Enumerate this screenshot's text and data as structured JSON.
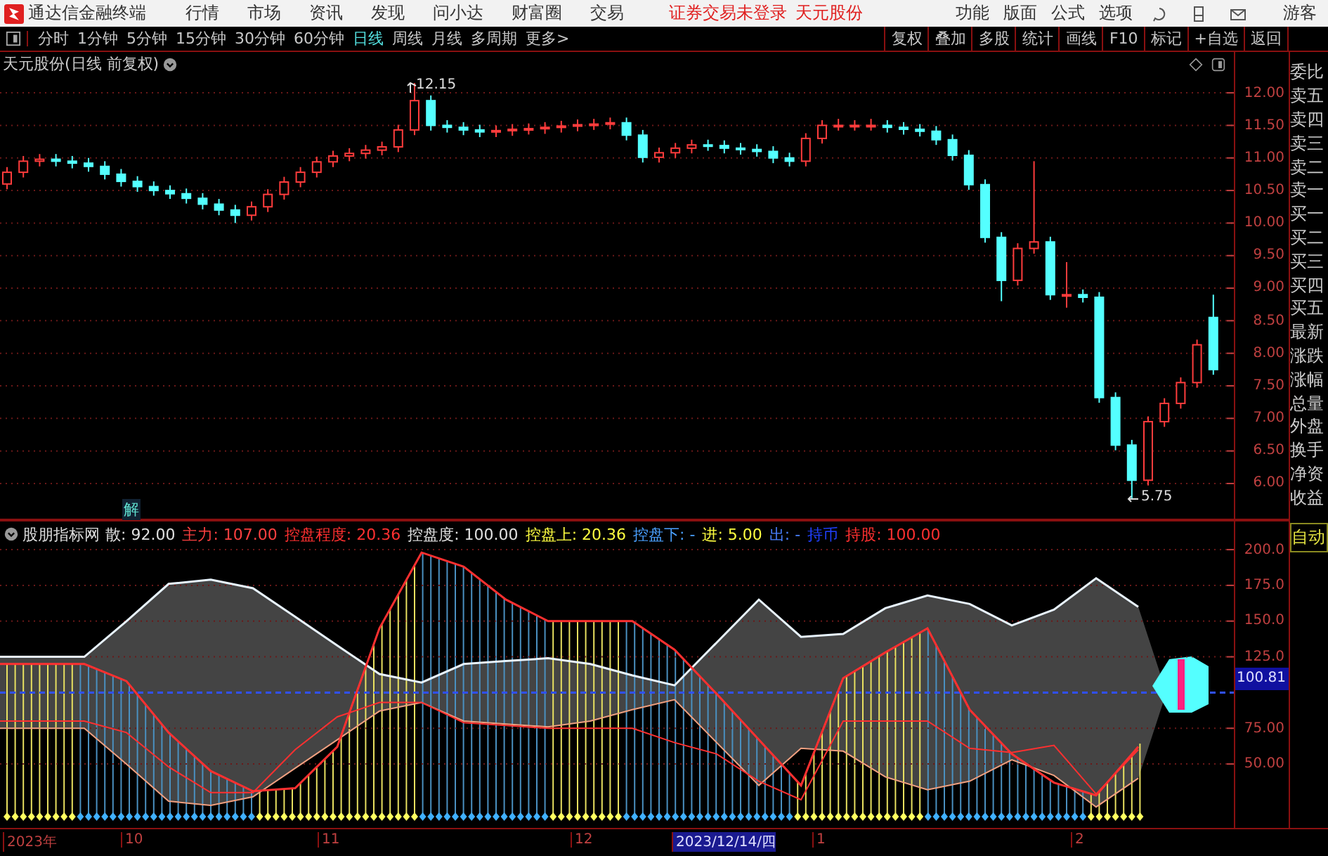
{
  "app": {
    "title": "通达信金融终端"
  },
  "menu": [
    "行情",
    "市场",
    "资讯",
    "发现",
    "问小达",
    "财富圈",
    "交易"
  ],
  "status": [
    "证券交易未登录",
    "天元股份"
  ],
  "right_menu": [
    "功能",
    "版面",
    "公式",
    "选项"
  ],
  "user": "游客",
  "periods": [
    {
      "label": "分时",
      "selected": false
    },
    {
      "label": "1分钟",
      "selected": false
    },
    {
      "label": "5分钟",
      "selected": false
    },
    {
      "label": "15分钟",
      "selected": false
    },
    {
      "label": "30分钟",
      "selected": false
    },
    {
      "label": "60分钟",
      "selected": false
    },
    {
      "label": "日线",
      "selected": true
    },
    {
      "label": "周线",
      "selected": false
    },
    {
      "label": "月线",
      "selected": false
    },
    {
      "label": "多周期",
      "selected": false
    },
    {
      "label": "更多>",
      "selected": false
    }
  ],
  "tools": [
    "复权",
    "叠加",
    "多股",
    "统计",
    "画线",
    "F10",
    "标记",
    "+自选",
    "返回"
  ],
  "chart": {
    "title": "天元股份(日线 前复权)",
    "high_label": "12.15",
    "low_label": "5.75",
    "chart_data": {
      "type": "candlestick",
      "grid": true,
      "ylim": [
        5.46,
        12.26
      ],
      "yticks": [
        {
          "value": 12,
          "label": "12.00"
        },
        {
          "value": 11.5,
          "label": "11.50"
        },
        {
          "value": 11,
          "label": "11.00"
        },
        {
          "value": 10.5,
          "label": "10.50"
        },
        {
          "value": 10,
          "label": "10.00"
        },
        {
          "value": 9.5,
          "label": "9.50"
        },
        {
          "value": 9,
          "label": "9.00"
        },
        {
          "value": 8.5,
          "label": "8.50"
        },
        {
          "value": 8,
          "label": "8.00"
        },
        {
          "value": 7.5,
          "label": "7.50"
        },
        {
          "value": 7,
          "label": "7.00"
        },
        {
          "value": 6.5,
          "label": "6.50"
        },
        {
          "value": 6,
          "label": "6.00"
        }
      ],
      "ohlc": [
        [
          10.6,
          10.86,
          10.52,
          10.78
        ],
        [
          10.78,
          11.03,
          10.7,
          10.95
        ],
        [
          10.95,
          11.06,
          10.87,
          10.98
        ],
        [
          10.98,
          11.06,
          10.87,
          10.95
        ],
        [
          10.95,
          11.03,
          10.84,
          10.92
        ],
        [
          10.92,
          11.0,
          10.79,
          10.87
        ],
        [
          10.87,
          10.95,
          10.67,
          10.75
        ],
        [
          10.75,
          10.83,
          10.56,
          10.64
        ],
        [
          10.64,
          10.72,
          10.48,
          10.56
        ],
        [
          10.56,
          10.64,
          10.42,
          10.5
        ],
        [
          10.5,
          10.58,
          10.37,
          10.45
        ],
        [
          10.45,
          10.53,
          10.3,
          10.38
        ],
        [
          10.38,
          10.46,
          10.21,
          10.29
        ],
        [
          10.29,
          10.37,
          10.12,
          10.2
        ],
        [
          10.2,
          10.28,
          10.0,
          10.12
        ],
        [
          10.12,
          10.33,
          10.04,
          10.25
        ],
        [
          10.25,
          10.52,
          10.17,
          10.44
        ],
        [
          10.44,
          10.71,
          10.36,
          10.63
        ],
        [
          10.63,
          10.86,
          10.55,
          10.78
        ],
        [
          10.78,
          11.02,
          10.7,
          10.94
        ],
        [
          10.94,
          11.11,
          10.86,
          11.03
        ],
        [
          11.03,
          11.15,
          10.95,
          11.07
        ],
        [
          11.07,
          11.2,
          10.99,
          11.12
        ],
        [
          11.12,
          11.25,
          11.04,
          11.17
        ],
        [
          11.17,
          11.51,
          11.09,
          11.43
        ],
        [
          11.43,
          12.15,
          11.35,
          11.88
        ],
        [
          11.88,
          11.96,
          11.42,
          11.5
        ],
        [
          11.5,
          11.58,
          11.39,
          11.47
        ],
        [
          11.47,
          11.55,
          11.35,
          11.43
        ],
        [
          11.43,
          11.51,
          11.32,
          11.4
        ],
        [
          11.4,
          11.5,
          11.32,
          11.42
        ],
        [
          11.42,
          11.52,
          11.34,
          11.44
        ],
        [
          11.44,
          11.53,
          11.36,
          11.45
        ],
        [
          11.45,
          11.55,
          11.37,
          11.47
        ],
        [
          11.47,
          11.57,
          11.39,
          11.49
        ],
        [
          11.49,
          11.59,
          11.41,
          11.51
        ],
        [
          11.51,
          11.6,
          11.43,
          11.52
        ],
        [
          11.52,
          11.62,
          11.44,
          11.54
        ],
        [
          11.54,
          11.62,
          11.27,
          11.35
        ],
        [
          11.35,
          11.43,
          10.93,
          11.01
        ],
        [
          11.01,
          11.16,
          10.93,
          11.08
        ],
        [
          11.08,
          11.23,
          11.0,
          11.15
        ],
        [
          11.15,
          11.28,
          11.07,
          11.2
        ],
        [
          11.2,
          11.28,
          11.11,
          11.19
        ],
        [
          11.19,
          11.27,
          11.07,
          11.15
        ],
        [
          11.15,
          11.23,
          11.05,
          11.13
        ],
        [
          11.13,
          11.21,
          11.02,
          11.1
        ],
        [
          11.1,
          11.18,
          10.92,
          11.0
        ],
        [
          11.0,
          11.08,
          10.87,
          10.95
        ],
        [
          10.95,
          11.38,
          10.87,
          11.3
        ],
        [
          11.3,
          11.58,
          11.22,
          11.5
        ],
        [
          11.5,
          11.6,
          11.42,
          11.5
        ],
        [
          11.5,
          11.58,
          11.42,
          11.5
        ],
        [
          11.5,
          11.6,
          11.42,
          11.5
        ],
        [
          11.5,
          11.58,
          11.39,
          11.47
        ],
        [
          11.47,
          11.55,
          11.36,
          11.44
        ],
        [
          11.44,
          11.52,
          11.33,
          11.41
        ],
        [
          11.41,
          11.49,
          11.2,
          11.28
        ],
        [
          11.28,
          11.36,
          10.96,
          11.04
        ],
        [
          11.04,
          11.12,
          10.51,
          10.59
        ],
        [
          10.59,
          10.67,
          9.7,
          9.78
        ],
        [
          9.78,
          9.86,
          8.8,
          9.12
        ],
        [
          9.12,
          9.69,
          9.04,
          9.61
        ],
        [
          9.61,
          10.95,
          9.53,
          9.71
        ],
        [
          9.71,
          9.79,
          8.82,
          8.9
        ],
        [
          8.9,
          9.4,
          8.7,
          8.9
        ],
        [
          8.9,
          8.98,
          8.78,
          8.86
        ],
        [
          8.86,
          8.94,
          7.24,
          7.32
        ],
        [
          7.32,
          7.4,
          6.51,
          6.59
        ],
        [
          6.59,
          6.67,
          5.75,
          6.05
        ],
        [
          6.05,
          7.03,
          5.97,
          6.95
        ],
        [
          6.95,
          7.31,
          6.87,
          7.23
        ],
        [
          7.23,
          7.63,
          7.15,
          7.55
        ],
        [
          7.55,
          8.21,
          7.47,
          8.13
        ],
        [
          8.55,
          8.9,
          7.67,
          7.75
        ]
      ]
    }
  },
  "signal": "解",
  "indicator": {
    "name": "股朋指标网",
    "items": [
      {
        "label": "散:",
        "value": "92.00",
        "color": "#e0e0e0"
      },
      {
        "label": "主力:",
        "value": "107.00",
        "color": "#ff4040"
      },
      {
        "label": "控盘程度:",
        "value": "20.36",
        "color": "#ff3030"
      },
      {
        "label": "控盘度:",
        "value": "100.00",
        "color": "#e0e0e0"
      },
      {
        "label": "控盘上:",
        "value": "20.36",
        "color": "#ffff40"
      },
      {
        "label": "控盘下:",
        "value": "-",
        "color": "#4aa0ff"
      },
      {
        "label": "进:",
        "value": "5.00",
        "color": "#ffff40"
      },
      {
        "label": "出:",
        "value": "-",
        "color": "#4a80ff"
      },
      {
        "label": "持币",
        "value": "",
        "color": "#2040ff"
      },
      {
        "label": "持股:",
        "value": "100.00",
        "color": "#ff3030"
      }
    ],
    "current": "100.81",
    "chart_data": {
      "type": "line",
      "grid": true,
      "ylim": [
        5.3,
        202
      ],
      "yticks": [
        {
          "value": 200,
          "label": "200.0"
        },
        {
          "value": 175,
          "label": "175.0"
        },
        {
          "value": 150,
          "label": "150.0"
        },
        {
          "value": 125,
          "label": "125.0"
        },
        {
          "value": 75,
          "label": "75.00"
        },
        {
          "value": 50,
          "label": "50.00"
        }
      ],
      "series": [
        {
          "color": "#e8f4ff",
          "values": [
            125,
            125,
            125,
            150,
            176,
            179,
            173,
            153,
            133,
            113,
            107,
            120,
            122,
            124,
            120,
            112,
            105,
            135,
            165,
            139,
            141,
            159,
            168,
            162,
            147,
            158,
            180,
            160,
            null
          ]
        },
        {
          "color": "#f0a080",
          "values": [
            75,
            75,
            75,
            50,
            24,
            21,
            27,
            47,
            67,
            87,
            93,
            80,
            78,
            76,
            80,
            88,
            95,
            65,
            35,
            61,
            59,
            41,
            32,
            38,
            53,
            42,
            20,
            40,
            null
          ]
        },
        {
          "color": "#ff3030",
          "values": [
            120,
            120,
            120,
            108,
            72,
            45,
            31,
            33,
            62,
            145,
            198,
            188,
            165,
            150,
            150,
            150,
            130,
            99,
            67,
            35,
            110,
            128,
            145,
            88,
            57,
            37,
            28,
            62,
            null
          ]
        },
        {
          "color": "#ff3030",
          "values": [
            80,
            80,
            80,
            72,
            48,
            30,
            30,
            60,
            83,
            93,
            93,
            79,
            77,
            75,
            75,
            75,
            65,
            57,
            38,
            25,
            80,
            80,
            80,
            61,
            58,
            63,
            29,
            60,
            null
          ]
        }
      ]
    }
  },
  "sidebar": [
    "委比",
    "卖五",
    "卖四",
    "卖三",
    "卖二",
    "卖一",
    "买一",
    "买二",
    "买三",
    "买四",
    "买五",
    "最新",
    "涨跌",
    "涨幅",
    "总量",
    "外盘",
    "换手",
    "净资",
    "收益"
  ],
  "sidebar_mode": "自动",
  "dates": [
    {
      "label": "2023年",
      "selected": false
    },
    {
      "label": "10",
      "selected": false
    },
    {
      "label": "11",
      "selected": false
    },
    {
      "label": "12",
      "selected": false
    },
    {
      "label": "2023/12/14/四",
      "selected": true
    },
    {
      "label": "1",
      "selected": false
    },
    {
      "label": "2",
      "selected": false
    }
  ]
}
